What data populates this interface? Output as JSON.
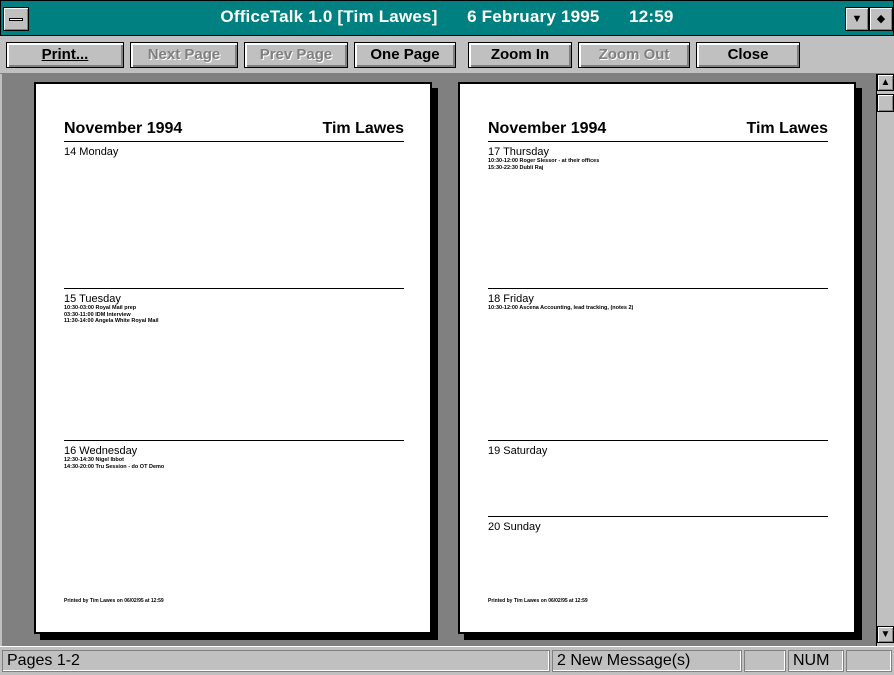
{
  "window": {
    "title": "OfficeTalk 1.0 [Tim Lawes]      6 February 1995      12:59",
    "system_menu_icon": "system-menu-bar",
    "minimize_glyph": "▼",
    "restore_glyph": "◆"
  },
  "toolbar": {
    "print": "Print...",
    "next_page": "Next Page",
    "prev_page": "Prev Page",
    "one_page": "One Page",
    "zoom_in": "Zoom In",
    "zoom_out": "Zoom Out",
    "close": "Close"
  },
  "pages": [
    {
      "month": "November 1994",
      "owner": "Tim Lawes",
      "days": [
        {
          "name": "14 Monday",
          "events": []
        },
        {
          "name": "15 Tuesday",
          "events": [
            "10:30-03:00 Royal Mail prep",
            "03:30-11:00 IDM Interview",
            "11:30-14:00 Angela White Royal Mail"
          ]
        },
        {
          "name": "16 Wednesday",
          "events": [
            "12:30-14:30 Nigel Ibbot",
            "14:30-20:00 Tru Session - do OT Demo"
          ]
        }
      ],
      "footer": "Printed by Tim Lawes on 06/02/95 at 12:59"
    },
    {
      "month": "November 1994",
      "owner": "Tim Lawes",
      "days": [
        {
          "name": "17 Thursday",
          "events": [
            "10:30-12:00 Roger Slessor - at their offices",
            "15:30-22:30 Dubli Raj"
          ]
        },
        {
          "name": "18 Friday",
          "events": [
            "10:30-12:00 Ascena Accounting, lead tracking, (notes 2)"
          ]
        },
        {
          "name": "19 Saturday",
          "events": []
        },
        {
          "name": "20 Sunday",
          "events": []
        }
      ],
      "footer": "Printed by Tim Lawes on 06/02/95 at 12:59"
    }
  ],
  "scrollbar": {
    "up_glyph": "▲",
    "down_glyph": "▼"
  },
  "status": {
    "pages": "Pages 1-2",
    "messages": "2 New Message(s)",
    "blank": "",
    "num": "NUM",
    "blank2": ""
  }
}
